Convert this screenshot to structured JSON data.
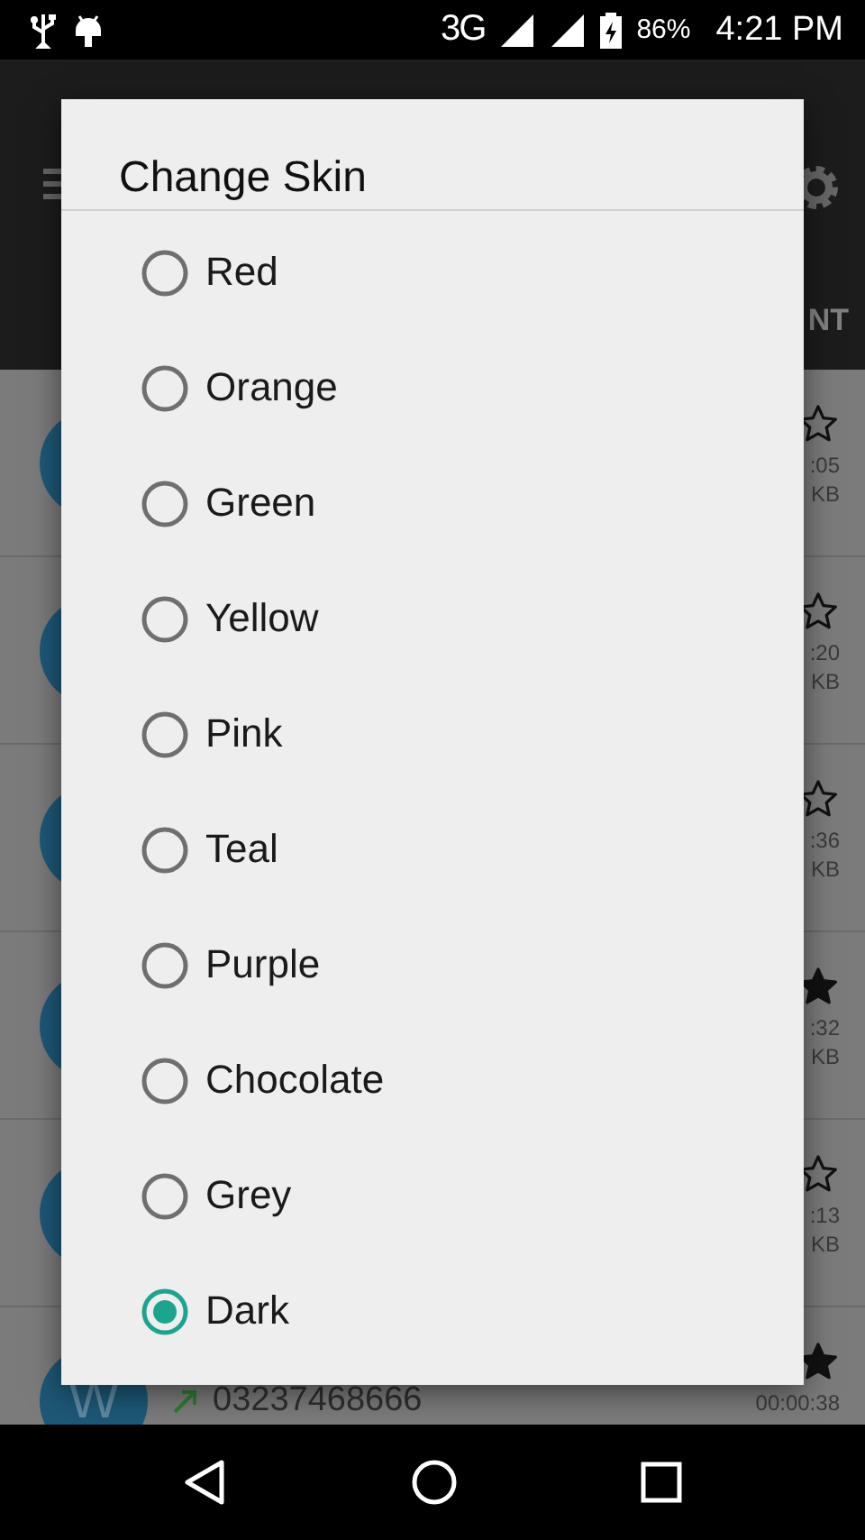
{
  "status_bar": {
    "network": "3G",
    "battery": "86%",
    "time": "4:21 PM"
  },
  "app_bar": {
    "tab_fragment": "NT"
  },
  "recordings": [
    {
      "starred": false,
      "duration": ":05",
      "size": "KB"
    },
    {
      "starred": false,
      "duration": ":20",
      "size": "KB"
    },
    {
      "starred": false,
      "duration": ":36",
      "size": "KB"
    },
    {
      "starred": true,
      "duration": ":32",
      "size": "KB"
    },
    {
      "starred": false,
      "duration": ":13",
      "size": "KB"
    },
    {
      "starred": true,
      "avatar": "W",
      "number": "03237468666",
      "duration": "00:00:38"
    }
  ],
  "dialog": {
    "title": "Change Skin",
    "options": [
      {
        "label": "Red",
        "selected": false
      },
      {
        "label": "Orange",
        "selected": false
      },
      {
        "label": "Green",
        "selected": false
      },
      {
        "label": "Yellow",
        "selected": false
      },
      {
        "label": "Pink",
        "selected": false
      },
      {
        "label": "Teal",
        "selected": false
      },
      {
        "label": "Purple",
        "selected": false
      },
      {
        "label": "Chocolate",
        "selected": false
      },
      {
        "label": "Grey",
        "selected": false
      },
      {
        "label": "Dark",
        "selected": true
      }
    ]
  }
}
